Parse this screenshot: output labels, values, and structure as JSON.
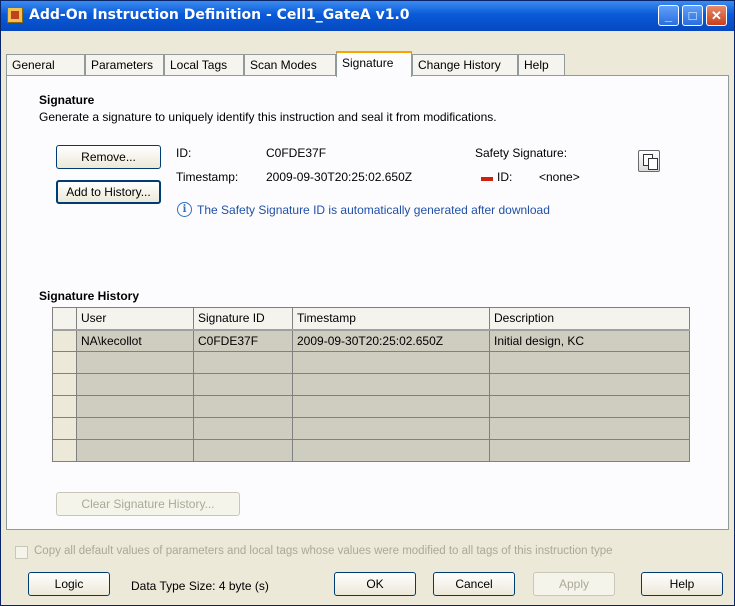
{
  "window": {
    "title": "Add-On Instruction Definition - Cell1_GateA v1.0",
    "minimize_glyph": "_",
    "maximize_glyph": "□",
    "close_glyph": "✕"
  },
  "tabs": [
    {
      "label": "General"
    },
    {
      "label": "Parameters"
    },
    {
      "label": "Local Tags"
    },
    {
      "label": "Scan Modes"
    },
    {
      "label": "Signature",
      "active": true
    },
    {
      "label": "Change History"
    },
    {
      "label": "Help"
    }
  ],
  "signature": {
    "heading": "Signature",
    "description": "Generate a signature to uniquely identify this instruction and seal it from modifications.",
    "remove_button": "Remove...",
    "add_history_button": "Add to History...",
    "id_label": "ID:",
    "id_value": "C0FDE37F",
    "timestamp_label": "Timestamp:",
    "timestamp_value": "2009-09-30T20:25:02.650Z",
    "safety_label": "Safety Signature:",
    "safety_id_label": "ID:",
    "safety_id_value": "<none>",
    "info_glyph": "i",
    "info_text": "The Safety Signature ID is automatically generated after download"
  },
  "history": {
    "heading": "Signature History",
    "columns": [
      "User",
      "Signature ID",
      "Timestamp",
      "Description"
    ],
    "rows": [
      [
        "NA\\kecollot",
        "C0FDE37F",
        "2009-09-30T20:25:02.650Z",
        "Initial design, KC"
      ],
      [
        "",
        "",
        "",
        ""
      ],
      [
        "",
        "",
        "",
        ""
      ],
      [
        "",
        "",
        "",
        ""
      ],
      [
        "",
        "",
        "",
        ""
      ],
      [
        "",
        "",
        "",
        ""
      ]
    ],
    "clear_button": "Clear Signature History..."
  },
  "footer": {
    "copy_defaults_text": "Copy all default values of parameters and local tags whose values were modified to all tags of this instruction type",
    "logic_button": "Logic",
    "data_type_size": "Data Type Size: 4 byte (s)",
    "ok_button": "OK",
    "cancel_button": "Cancel",
    "apply_button": "Apply",
    "help_button": "Help"
  }
}
